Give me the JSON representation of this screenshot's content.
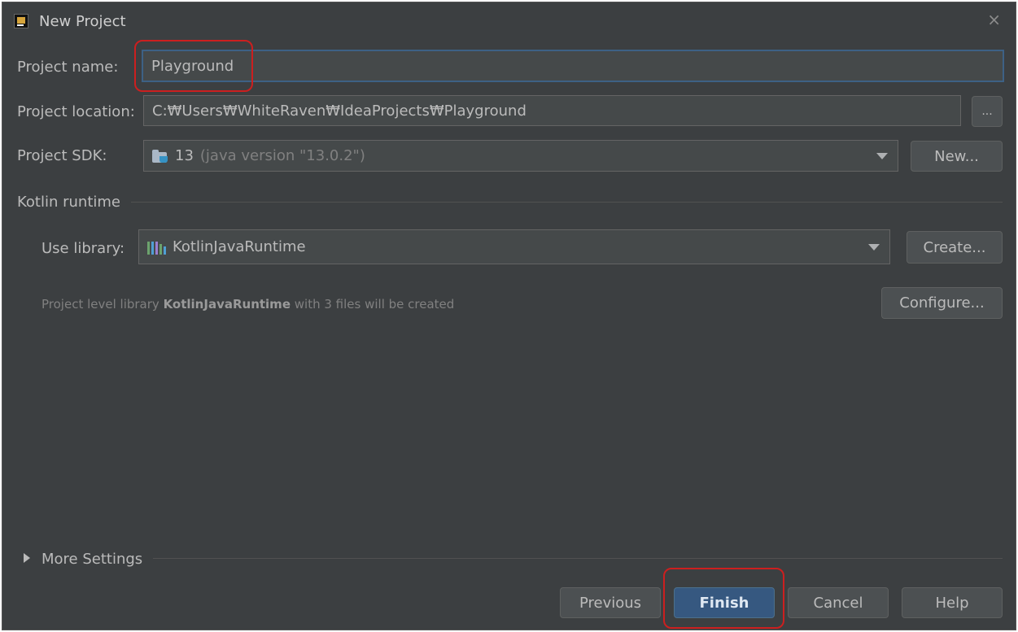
{
  "window": {
    "title": "New Project",
    "close_glyph": "×"
  },
  "form": {
    "project_name_label": "Project name:",
    "project_name_value": "Playground",
    "project_location_label": "Project location:",
    "project_location_value": "C:₩Users₩WhiteRaven₩IdeaProjects₩Playground",
    "browse_label": "...",
    "project_sdk_label": "Project SDK:",
    "sdk_version": "13",
    "sdk_detail": "(java version \"13.0.2\")",
    "new_label": "New..."
  },
  "kotlin": {
    "section_title": "Kotlin runtime",
    "use_library_label": "Use library:",
    "library_value": "KotlinJavaRuntime",
    "create_label": "Create...",
    "hint_prefix": "Project level library ",
    "hint_library": "KotlinJavaRuntime",
    "hint_suffix": " with 3 files will be created",
    "configure_label": "Configure..."
  },
  "more_settings": {
    "label": "More Settings"
  },
  "footer": {
    "previous_label": "Previous",
    "finish_label": "Finish",
    "cancel_label": "Cancel",
    "help_label": "Help"
  },
  "icons": {
    "app": "intellij-app-icon",
    "sdk": "java-sdk-folder-icon",
    "library": "library-bars-icon",
    "library_colors": [
      "#6ca36d",
      "#4f9fd4",
      "#9a7fd1",
      "#6ca36d",
      "#4f9fd4"
    ]
  },
  "colors": {
    "background": "#3c3f41",
    "accent": "#365880",
    "highlight": "#cc1f1f"
  }
}
